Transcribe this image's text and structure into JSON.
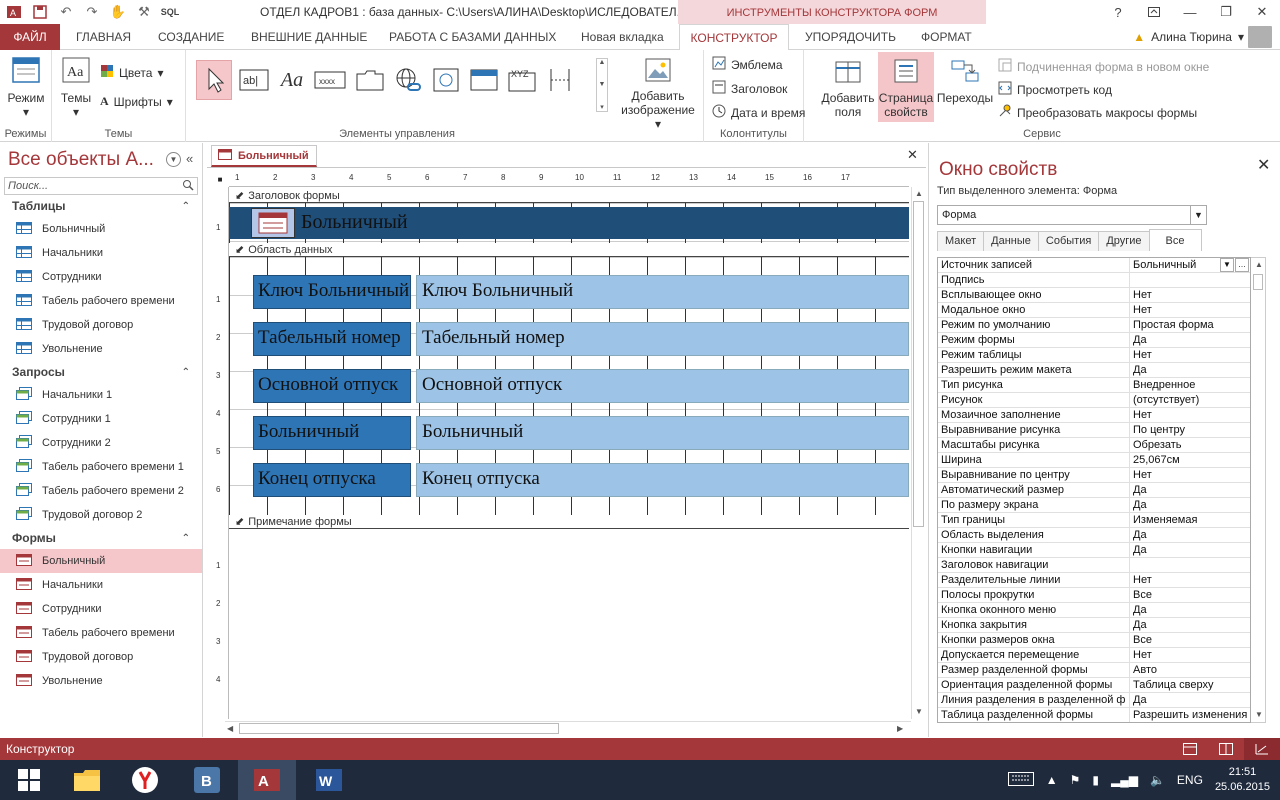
{
  "window": {
    "title": "ОТДЕЛ КАДРОВ1 : база данных- C:\\Users\\АЛИНА\\Desktop\\ИСЛЕДОВАТЕЛ...",
    "context_title": "ИНСТРУМЕНТЫ КОНСТРУКТОРА ФОРМ",
    "sql": "SQL",
    "help": "?",
    "minimize": "—",
    "restore": "❐",
    "close": "✕"
  },
  "ribbon_tabs": [
    "ФАЙЛ",
    "ГЛАВНАЯ",
    "СОЗДАНИЕ",
    "ВНЕШНИЕ ДАННЫЕ",
    "РАБОТА С БАЗАМИ ДАННЫХ",
    "Новая вкладка",
    "КОНСТРУКТОР",
    "УПОРЯДОЧИТЬ",
    "ФОРМАТ"
  ],
  "user": {
    "name": "Алина Тюрина",
    "dropdown": "▾"
  },
  "ribbon": {
    "modes": {
      "label": "Режим",
      "group": "Режимы"
    },
    "themes": {
      "label": "Темы",
      "colors": "Цвета",
      "fonts": "Шрифты",
      "group": "Темы"
    },
    "controls": {
      "group": "Элементы управления",
      "textbox": "ab|",
      "label": "Aa",
      "button": "xxxx",
      "xyz": "XYZ"
    },
    "image": {
      "label1": "Добавить",
      "label2": "изображение"
    },
    "header_footer": {
      "group": "Колонтитулы",
      "logo": "Эмблема",
      "title": "Заголовок",
      "datetime": "Дата и время"
    },
    "tools": {
      "group": "Сервис",
      "add_fields1": "Добавить",
      "add_fields2": "поля",
      "prop_sheet1": "Страница",
      "prop_sheet2": "свойств",
      "transitions": "Переходы",
      "subform": "Подчиненная форма в новом окне",
      "view_code": "Просмотреть код",
      "convert_macros": "Преобразовать макросы формы"
    }
  },
  "nav": {
    "title": "Все объекты А...",
    "search_placeholder": "Поиск...",
    "sections": [
      {
        "name": "Таблицы",
        "items": [
          "Больничный",
          "Начальники",
          "Сотрудники",
          "Табель рабочего времени",
          "Трудовой договор",
          "Увольнение"
        ]
      },
      {
        "name": "Запросы",
        "items": [
          "Начальники 1",
          "Сотрудники 1",
          "Сотрудники 2",
          "Табель рабочего времени 1",
          "Табель рабочего времени 2",
          "Трудовой договор 2"
        ]
      },
      {
        "name": "Формы",
        "items": [
          "Больничный",
          "Начальники",
          "Сотрудники",
          "Табель рабочего времени",
          "Трудовой договор",
          "Увольнение"
        ]
      }
    ]
  },
  "document": {
    "tab": "Больничный",
    "close": "✕",
    "ruler_h": [
      "1",
      "2",
      "3",
      "4",
      "5",
      "6",
      "7",
      "8",
      "9",
      "10",
      "11",
      "12",
      "13",
      "14",
      "15",
      "16",
      "17"
    ],
    "ruler_v_top": [
      "1"
    ],
    "ruler_v_body": [
      "1",
      "2",
      "3",
      "4",
      "5",
      "6"
    ],
    "ruler_v_footer": [
      "1",
      "2",
      "3",
      "4"
    ],
    "header_section": "Заголовок формы",
    "detail_section": "Область данных",
    "footer_section": "Примечание формы",
    "form_title": "Больничный",
    "fields": [
      {
        "label": "Ключ Больничный",
        "value": "Ключ Больничный"
      },
      {
        "label": "Табельный номер",
        "value": "Табельный номер"
      },
      {
        "label": "Основной отпуск",
        "value": "Основной отпуск"
      },
      {
        "label": "Больничный",
        "value": "Больничный"
      },
      {
        "label": "Конец отпуска",
        "value": "Конец отпуска"
      }
    ]
  },
  "props": {
    "title": "Окно свойств",
    "close": "✕",
    "type_label": "Тип выделенного элемента:  Форма",
    "selected": "Форма",
    "tabs": [
      "Макет",
      "Данные",
      "События",
      "Другие",
      "Все"
    ],
    "rows": [
      [
        "Источник записей",
        "Больничный"
      ],
      [
        "Подпись",
        ""
      ],
      [
        "Всплывающее окно",
        "Нет"
      ],
      [
        "Модальное окно",
        "Нет"
      ],
      [
        "Режим по умолчанию",
        "Простая форма"
      ],
      [
        "Режим формы",
        "Да"
      ],
      [
        "Режим таблицы",
        "Нет"
      ],
      [
        "Разрешить режим макета",
        "Да"
      ],
      [
        "Тип рисунка",
        "Внедренное"
      ],
      [
        "Рисунок",
        "(отсутствует)"
      ],
      [
        "Мозаичное заполнение",
        "Нет"
      ],
      [
        "Выравнивание рисунка",
        "По центру"
      ],
      [
        "Масштабы рисунка",
        "Обрезать"
      ],
      [
        "Ширина",
        "25,067см"
      ],
      [
        "Выравнивание по центру",
        "Нет"
      ],
      [
        "Автоматический размер",
        "Да"
      ],
      [
        "По размеру экрана",
        "Да"
      ],
      [
        "Тип границы",
        "Изменяемая"
      ],
      [
        "Область выделения",
        "Да"
      ],
      [
        "Кнопки навигации",
        "Да"
      ],
      [
        "Заголовок навигации",
        ""
      ],
      [
        "Разделительные линии",
        "Нет"
      ],
      [
        "Полосы прокрутки",
        "Все"
      ],
      [
        "Кнопка оконного меню",
        "Да"
      ],
      [
        "Кнопка закрытия",
        "Да"
      ],
      [
        "Кнопки размеров окна",
        "Все"
      ],
      [
        "Допускается перемещение",
        "Нет"
      ],
      [
        "Размер разделенной формы",
        "Авто"
      ],
      [
        "Ориентация разделенной формы",
        "Таблица сверху"
      ],
      [
        "Линия разделения в разделенной ф",
        "Да"
      ],
      [
        "Таблица разделенной формы",
        "Разрешить изменения"
      ]
    ]
  },
  "status": {
    "text": "Конструктор"
  },
  "taskbar": {
    "lang": "ENG",
    "time": "21:51",
    "date": "25.06.2015",
    "word_letter": "W",
    "vk_letter": "B",
    "access_letter": "A"
  },
  "colors": {
    "accent": "#a4373a",
    "header_fill": "#1f4e79",
    "label_fill": "#2e75b6",
    "field_fill": "#9dc3e6"
  }
}
